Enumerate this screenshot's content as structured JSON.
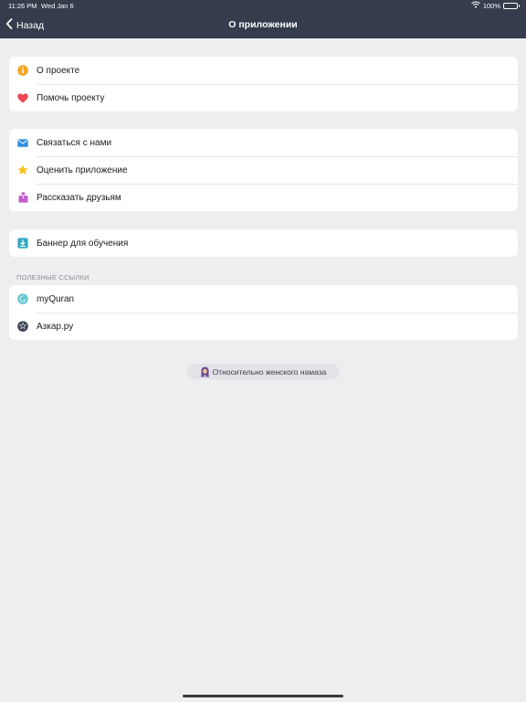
{
  "status_bar": {
    "time": "11:26 PM",
    "date": "Wed Jan 6",
    "battery": "100%"
  },
  "nav": {
    "back_label": "Назад",
    "title": "О приложении"
  },
  "groups": [
    {
      "items": [
        {
          "label": "О проекте",
          "icon": "info-icon"
        },
        {
          "label": "Помочь проекту",
          "icon": "heart-icon"
        }
      ]
    },
    {
      "items": [
        {
          "label": "Связаться с нами",
          "icon": "mail-icon"
        },
        {
          "label": "Оценить приложение",
          "icon": "star-icon"
        },
        {
          "label": "Рассказать друзьям",
          "icon": "share-icon"
        }
      ]
    },
    {
      "items": [
        {
          "label": "Баннер для обучения",
          "icon": "download-icon"
        }
      ]
    }
  ],
  "links_section": {
    "header": "ПОЛЕЗНЫЕ ССЫЛКИ",
    "items": [
      {
        "label": "myQuran",
        "icon": "myquran-icon"
      },
      {
        "label": "Азкар.ру",
        "icon": "azkar-icon"
      }
    ]
  },
  "pill": {
    "label": "Относительно женского намаза",
    "icon": "woman-hijab-icon"
  },
  "colors": {
    "nav_bar": "#353c4b",
    "background": "#eeeef1",
    "info": "#f5a623",
    "heart": "#ec4b56",
    "mail": "#2f8fdc",
    "star": "#f6c31d",
    "share": "#c45ecf",
    "download": "#2ea8c2"
  }
}
